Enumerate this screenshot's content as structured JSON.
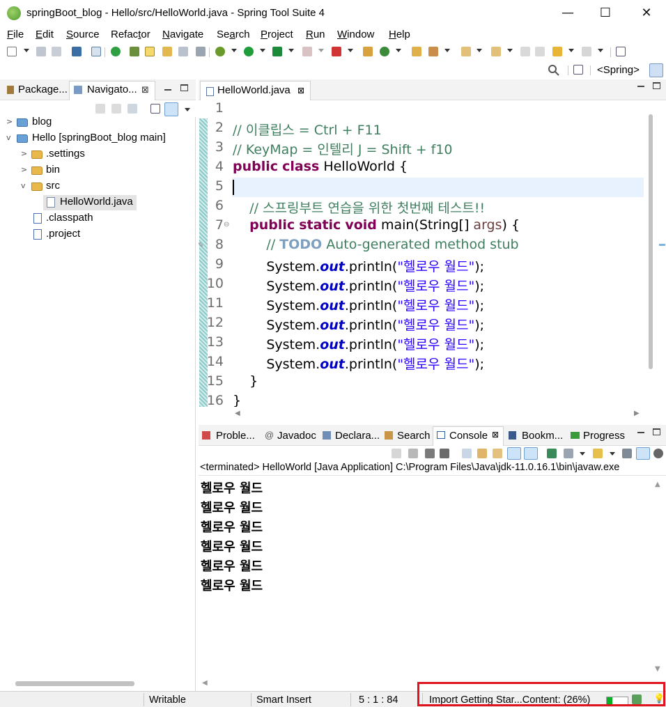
{
  "window": {
    "title": "springBoot_blog - Hello/src/HelloWorld.java - Spring Tool Suite 4",
    "minimize": "—",
    "maximize": "☐",
    "close": "✕"
  },
  "menu": {
    "items": [
      "File",
      "Edit",
      "Source",
      "Refactor",
      "Navigate",
      "Search",
      "Project",
      "Run",
      "Window",
      "Help"
    ],
    "mnemonics": [
      "F",
      "E",
      "S",
      "t",
      "N",
      "a",
      "P",
      "R",
      "W",
      "H"
    ]
  },
  "toolbar": {
    "perspective_label": "<Spring>"
  },
  "left_panel": {
    "tabs": [
      "Package...",
      "Navigato..."
    ],
    "close_glyph": "⊠",
    "tree": [
      {
        "label": "blog",
        "type": "project",
        "twisty": ">"
      },
      {
        "label": "Hello [springBoot_blog main]",
        "type": "project",
        "twisty": "v"
      },
      {
        "label": ".settings",
        "type": "folder",
        "twisty": ">"
      },
      {
        "label": "bin",
        "type": "folder",
        "twisty": ">"
      },
      {
        "label": "src",
        "type": "folder",
        "twisty": "v"
      },
      {
        "label": "HelloWorld.java",
        "type": "java-file",
        "selected": true
      },
      {
        "label": ".classpath",
        "type": "xml-file"
      },
      {
        "label": ".project",
        "type": "xml-file"
      }
    ]
  },
  "editor": {
    "tab_label": "HelloWorld.java",
    "current_line": 5,
    "lines": [
      {
        "num": "1",
        "parts": []
      },
      {
        "num": "2",
        "parts": [
          [
            "cmt",
            "// 이클립스 = Ctrl + F11"
          ]
        ]
      },
      {
        "num": "3",
        "parts": [
          [
            "cmt",
            "// KeyMap = 인텔리 J = Shift + f10"
          ]
        ]
      },
      {
        "num": "4",
        "parts": [
          [
            "kw",
            "public"
          ],
          [
            "",
            " "
          ],
          [
            "kw",
            "class"
          ],
          [
            "",
            " HelloWorld {"
          ]
        ]
      },
      {
        "num": "5",
        "parts": []
      },
      {
        "num": "6",
        "parts": [
          [
            "",
            "    "
          ],
          [
            "cmt",
            "// 스프링부트 연습을 위한 첫번째 테스트!!"
          ]
        ]
      },
      {
        "num": "7",
        "parts": [
          [
            "",
            "    "
          ],
          [
            "kw",
            "public"
          ],
          [
            "",
            " "
          ],
          [
            "kw",
            "static"
          ],
          [
            "",
            " "
          ],
          [
            "kw",
            "void"
          ],
          [
            "",
            " main(String[] "
          ],
          [
            "prm",
            "args"
          ],
          [
            "",
            ") {"
          ]
        ]
      },
      {
        "num": "8",
        "parts": [
          [
            "",
            "        "
          ],
          [
            "cmt",
            "// "
          ],
          [
            "todo",
            "TODO"
          ],
          [
            "cmt",
            " Auto-generated method stub"
          ]
        ]
      },
      {
        "num": "9",
        "parts": [
          [
            "",
            "        System."
          ],
          [
            "fld",
            "out"
          ],
          [
            "",
            ".println("
          ],
          [
            "str",
            "\"헬로우 월드\""
          ],
          [
            "",
            ");"
          ]
        ]
      },
      {
        "num": "10",
        "parts": [
          [
            "",
            "        System."
          ],
          [
            "fld",
            "out"
          ],
          [
            "",
            ".println("
          ],
          [
            "str",
            "\"헬로우 월드\""
          ],
          [
            "",
            ");"
          ]
        ]
      },
      {
        "num": "11",
        "parts": [
          [
            "",
            "        System."
          ],
          [
            "fld",
            "out"
          ],
          [
            "",
            ".println("
          ],
          [
            "str",
            "\"헬로우 월드\""
          ],
          [
            "",
            ");"
          ]
        ]
      },
      {
        "num": "12",
        "parts": [
          [
            "",
            "        System."
          ],
          [
            "fld",
            "out"
          ],
          [
            "",
            ".println("
          ],
          [
            "str",
            "\"헬로우 월드\""
          ],
          [
            "",
            ");"
          ]
        ]
      },
      {
        "num": "13",
        "parts": [
          [
            "",
            "        System."
          ],
          [
            "fld",
            "out"
          ],
          [
            "",
            ".println("
          ],
          [
            "str",
            "\"헬로우 월드\""
          ],
          [
            "",
            ");"
          ]
        ]
      },
      {
        "num": "14",
        "parts": [
          [
            "",
            "        System."
          ],
          [
            "fld",
            "out"
          ],
          [
            "",
            ".println("
          ],
          [
            "str",
            "\"헬로우 월드\""
          ],
          [
            "",
            ");"
          ]
        ]
      },
      {
        "num": "15",
        "parts": [
          [
            "",
            "    }"
          ]
        ]
      },
      {
        "num": "16",
        "parts": [
          [
            "",
            "}"
          ]
        ]
      }
    ]
  },
  "bottom_panel": {
    "tabs": [
      "Proble...",
      "Javadoc",
      "Declara...",
      "Search",
      "Console",
      "Bookm...",
      "Progress"
    ],
    "active_tab": "Console",
    "description": "<terminated> HelloWorld [Java Application] C:\\Program Files\\Java\\jdk-11.0.16.1\\bin\\javaw.exe",
    "output": [
      "헬로우 월드",
      "헬로우 월드",
      "헬로우 월드",
      "헬로우 월드",
      "헬로우 월드",
      "헬로우 월드"
    ]
  },
  "status": {
    "writable": "Writable",
    "insert_mode": "Smart Insert",
    "position": "5 : 1 : 84",
    "task": "Import Getting Star...Content: (26%)",
    "task_progress": 0.26
  },
  "colors": {
    "comment": "#3f7f5f",
    "keyword": "#7f0055",
    "string": "#2a00ff",
    "field": "#0000c0",
    "highlight_box": "#e0141e",
    "progress": "#06b025"
  }
}
